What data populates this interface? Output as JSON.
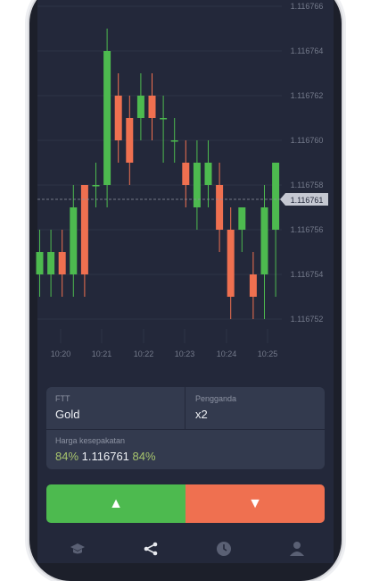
{
  "chart": {
    "y_ticks": [
      "1.116766",
      "1.116764",
      "1.116762",
      "1.116760",
      "1.116758",
      "1.116756",
      "1.116754",
      "1.116752"
    ],
    "x_ticks": [
      "10:20",
      "10:21",
      "10:22",
      "10:23",
      "10:24",
      "10:25"
    ],
    "current_price": "1.116761"
  },
  "chart_data": {
    "type": "candlestick",
    "ylim": [
      1.1167505,
      1.1167665
    ],
    "candles": [
      {
        "o": 1.116754,
        "c": 1.116755,
        "h": 1.116756,
        "l": 1.116753
      },
      {
        "o": 1.116754,
        "c": 1.116755,
        "h": 1.116756,
        "l": 1.116753
      },
      {
        "o": 1.116755,
        "c": 1.116754,
        "h": 1.116756,
        "l": 1.116753
      },
      {
        "o": 1.116754,
        "c": 1.116757,
        "h": 1.116758,
        "l": 1.116753
      },
      {
        "o": 1.116758,
        "c": 1.116754,
        "h": 1.116758,
        "l": 1.116753
      },
      {
        "o": 1.116758,
        "c": 1.116758,
        "h": 1.116759,
        "l": 1.116757
      },
      {
        "o": 1.116758,
        "c": 1.116764,
        "h": 1.116765,
        "l": 1.116757
      },
      {
        "o": 1.116762,
        "c": 1.11676,
        "h": 1.116763,
        "l": 1.116759
      },
      {
        "o": 1.116761,
        "c": 1.116759,
        "h": 1.116762,
        "l": 1.116758
      },
      {
        "o": 1.116761,
        "c": 1.116762,
        "h": 1.116763,
        "l": 1.11676
      },
      {
        "o": 1.116762,
        "c": 1.116761,
        "h": 1.116763,
        "l": 1.11676
      },
      {
        "o": 1.116761,
        "c": 1.116761,
        "h": 1.116762,
        "l": 1.116759
      },
      {
        "o": 1.11676,
        "c": 1.11676,
        "h": 1.116761,
        "l": 1.116759
      },
      {
        "o": 1.116759,
        "c": 1.116758,
        "h": 1.11676,
        "l": 1.116757
      },
      {
        "o": 1.116757,
        "c": 1.116759,
        "h": 1.11676,
        "l": 1.116756
      },
      {
        "o": 1.116758,
        "c": 1.116759,
        "h": 1.11676,
        "l": 1.116757
      },
      {
        "o": 1.116758,
        "c": 1.116756,
        "h": 1.116759,
        "l": 1.116755
      },
      {
        "o": 1.116756,
        "c": 1.116753,
        "h": 1.116757,
        "l": 1.116752
      },
      {
        "o": 1.116756,
        "c": 1.116757,
        "h": 1.116757,
        "l": 1.116755
      },
      {
        "o": 1.116754,
        "c": 1.116753,
        "h": 1.116755,
        "l": 1.116752
      },
      {
        "o": 1.116754,
        "c": 1.116757,
        "h": 1.116758,
        "l": 1.116752
      },
      {
        "o": 1.116756,
        "c": 1.116759,
        "h": 1.116759,
        "l": 1.116753
      }
    ]
  },
  "trade": {
    "asset_label": "FTT",
    "asset_value": "Gold",
    "multiplier_label": "Pengganda",
    "multiplier_value": "x2",
    "strike_label": "Harga kesepakatan",
    "pct_left": "84%",
    "strike_price": "1.116761",
    "pct_right": "84%"
  },
  "buttons": {
    "up_symbol": "▲",
    "down_symbol": "▼"
  },
  "nav": [
    "graduation-cap-icon",
    "share-icon",
    "clock-icon",
    "user-icon"
  ],
  "colors": {
    "up": "#4dba4f",
    "down": "#ef7050",
    "background": "#23283a",
    "panel": "#333a4e",
    "price_tag": "#c5c8d2"
  }
}
